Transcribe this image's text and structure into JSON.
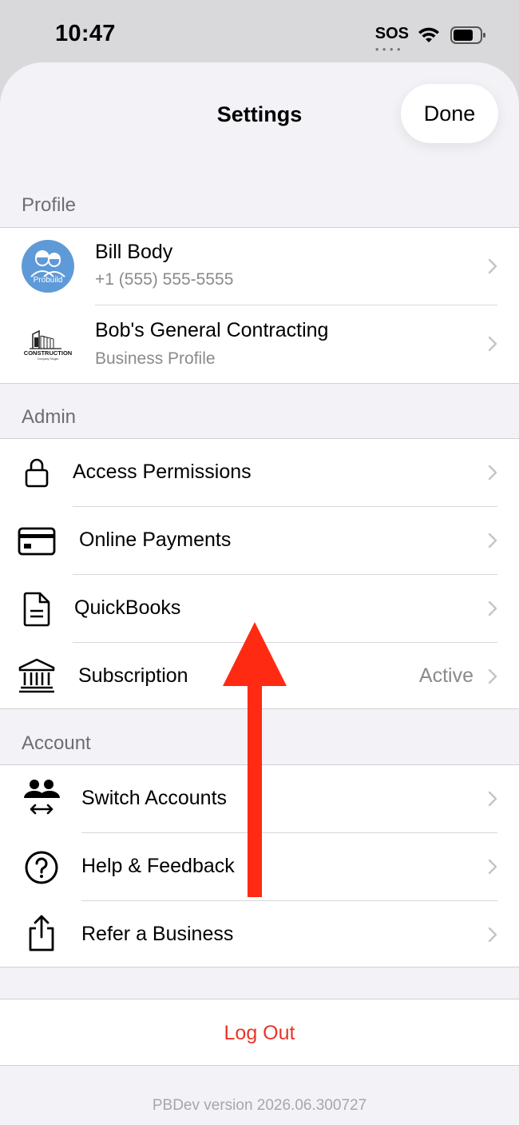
{
  "status_bar": {
    "time": "10:47",
    "sos": "SOS"
  },
  "header": {
    "title": "Settings",
    "done_label": "Done"
  },
  "profile": {
    "section_label": "Profile",
    "user": {
      "name": "Bill Body",
      "phone": "+1 (555) 555-5555",
      "avatar_text": "Probuild"
    },
    "business": {
      "name": "Bob's General Contracting",
      "subtitle": "Business Profile",
      "logo_text": "CONSTRUCTION",
      "logo_subtext": "Company Slogan"
    }
  },
  "admin": {
    "section_label": "Admin",
    "items": [
      {
        "label": "Access Permissions",
        "icon": "lock-icon"
      },
      {
        "label": "Online Payments",
        "icon": "credit-card-icon"
      },
      {
        "label": "QuickBooks",
        "icon": "document-icon"
      },
      {
        "label": "Subscription",
        "icon": "bank-icon",
        "value": "Active"
      }
    ]
  },
  "account": {
    "section_label": "Account",
    "items": [
      {
        "label": "Switch Accounts",
        "icon": "switch-accounts-icon"
      },
      {
        "label": "Help & Feedback",
        "icon": "help-icon"
      },
      {
        "label": "Refer a Business",
        "icon": "share-icon"
      }
    ]
  },
  "logout_label": "Log Out",
  "version_text": "PBDev version 2026.06.300727",
  "colors": {
    "destructive": "#e8352a",
    "annotation_arrow": "#ff2a12",
    "avatar_bg": "#5f9ad8"
  }
}
